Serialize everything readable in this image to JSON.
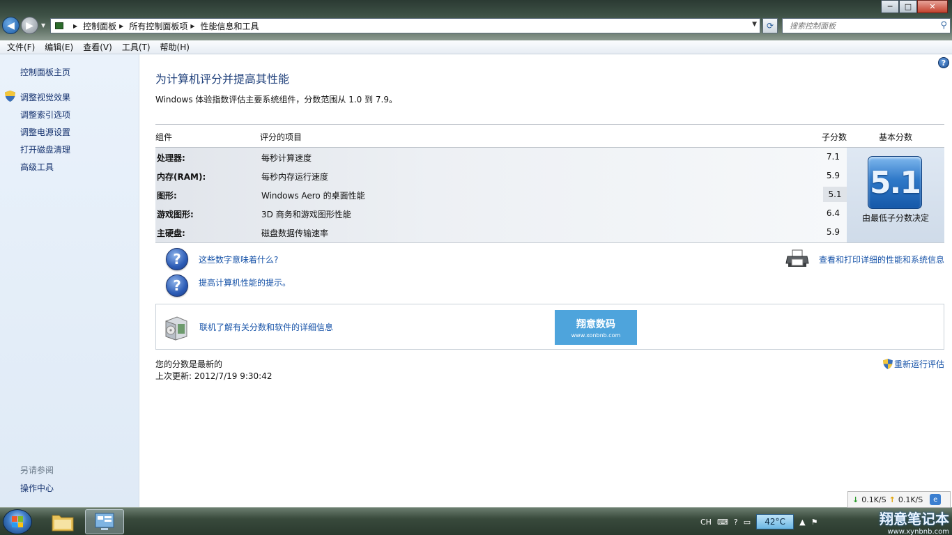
{
  "window": {
    "minimize_label": "─",
    "maximize_label": "□",
    "close_label": "✕"
  },
  "address": {
    "crumbs": [
      "控制面板",
      "所有控制面板项",
      "性能信息和工具"
    ]
  },
  "search": {
    "placeholder": "搜索控制面板"
  },
  "menu": [
    "文件(F)",
    "编辑(E)",
    "查看(V)",
    "工具(T)",
    "帮助(H)"
  ],
  "sidebar": {
    "home": "控制面板主页",
    "links": [
      "调整视觉效果",
      "调整索引选项",
      "调整电源设置",
      "打开磁盘清理",
      "高级工具"
    ],
    "see_also": "另请参阅",
    "see_also_links": [
      "操作中心"
    ]
  },
  "main": {
    "title": "为计算机评分并提高其性能",
    "subtitle": "Windows 体验指数评估主要系统组件，分数范围从 1.0 到 7.9。",
    "table": {
      "headers": {
        "component": "组件",
        "rated": "评分的项目",
        "subscore": "子分数",
        "base": "基本分数"
      },
      "rows": [
        {
          "component": "处理器:",
          "item": "每秒计算速度",
          "subscore": "7.1"
        },
        {
          "component": "内存(RAM):",
          "item": "每秒内存运行速度",
          "subscore": "5.9"
        },
        {
          "component": "图形:",
          "item": "Windows Aero 的桌面性能",
          "subscore": "5.1"
        },
        {
          "component": "游戏图形:",
          "item": "3D 商务和游戏图形性能",
          "subscore": "6.4"
        },
        {
          "component": "主硬盘:",
          "item": "磁盘数据传输速率",
          "subscore": "5.9"
        }
      ],
      "base_score": "5.1",
      "base_note": "由最低子分数决定"
    },
    "links": {
      "what_mean": "这些数字意味着什么?",
      "tips": "提高计算机性能的提示。",
      "print": "查看和打印详细的性能和系统信息",
      "online": "联机了解有关分数和软件的详细信息"
    },
    "ad": {
      "text": "翔意数码",
      "url": "www.xonbnb.com"
    },
    "status_current": "您的分数是最新的",
    "last_update": "上次更新: 2012/7/19 9:30:42",
    "rerun": "重新运行评估"
  },
  "taskbar": {
    "lang": "CH",
    "temp": "42°C",
    "net_down": "0.1K/S",
    "net_up": "0.1K/S",
    "watermark_title": "翔意笔记本",
    "watermark_url": "www.xynbnb.com"
  }
}
